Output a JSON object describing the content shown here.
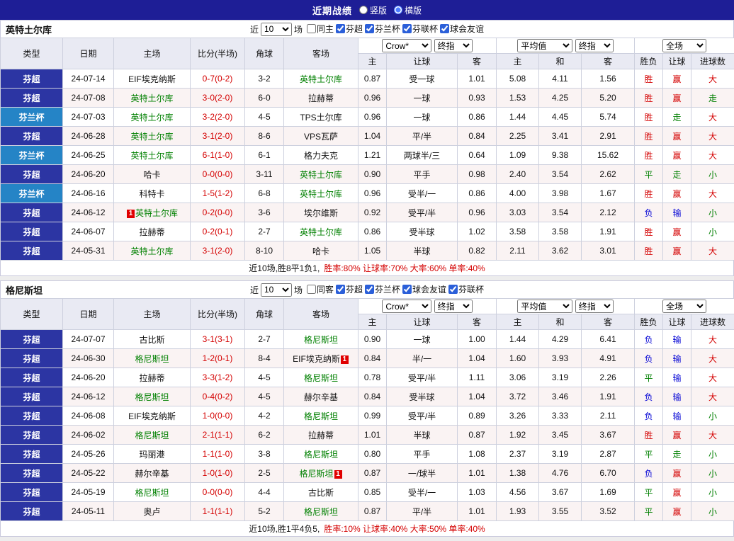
{
  "topbar": {
    "title": "近期战绩",
    "layout_options": [
      {
        "label": "竖版",
        "checked": false
      },
      {
        "label": "横版",
        "checked": true
      }
    ]
  },
  "table": {
    "columns": {
      "type": "类型",
      "date": "日期",
      "home": "主场",
      "score": "比分(半场)",
      "corner": "角球",
      "away": "客场",
      "odds_home": "主",
      "odds_handicap": "让球",
      "odds_away": "客",
      "avg_home": "主",
      "avg_draw": "和",
      "avg_away": "客",
      "res_wdl": "胜负",
      "res_handicap": "让球",
      "res_goals": "进球数"
    },
    "selects": {
      "odds_source": "Crow*",
      "odds_time": "终指",
      "avg_source": "平均值",
      "avg_time": "终指",
      "scope": "全场"
    }
  },
  "colors": {
    "topbar_bg": "#1e1e96",
    "league_super_bg": "#2c35a3",
    "league_cup_bg": "#2584c6",
    "win_red": "#d40000",
    "draw_green": "#008000",
    "loss_blue": "#0000d4"
  },
  "sections": [
    {
      "team": "英特土尔库",
      "filter": {
        "prefix": "近",
        "count": "10",
        "suffix": "场",
        "checkboxes": [
          {
            "label": "同主",
            "checked": false
          },
          {
            "label": "芬超",
            "checked": true
          },
          {
            "label": "芬兰杯",
            "checked": true
          },
          {
            "label": "芬联杯",
            "checked": true
          },
          {
            "label": "球会友谊",
            "checked": true
          }
        ]
      },
      "rows": [
        {
          "type": "芬超",
          "date": "24-07-14",
          "home": "EIF埃克纳斯",
          "score": "0-7(0-2)",
          "corner": "3-2",
          "away": "英特土尔库",
          "away_focus": true,
          "odds": [
            "0.87",
            "受一球",
            "1.01"
          ],
          "avg": [
            "5.08",
            "4.11",
            "1.56"
          ],
          "results": [
            "胜",
            "赢",
            "大"
          ]
        },
        {
          "type": "芬超",
          "date": "24-07-08",
          "home": "英特土尔库",
          "home_focus": true,
          "score": "3-0(2-0)",
          "corner": "6-0",
          "away": "拉赫蒂",
          "odds": [
            "0.96",
            "一球",
            "0.93"
          ],
          "avg": [
            "1.53",
            "4.25",
            "5.20"
          ],
          "results": [
            "胜",
            "赢",
            "走"
          ]
        },
        {
          "type": "芬兰杯",
          "date": "24-07-03",
          "home": "英特土尔库",
          "home_focus": true,
          "score": "3-2(2-0)",
          "corner": "4-5",
          "away": "TPS土尔库",
          "odds": [
            "0.96",
            "一球",
            "0.86"
          ],
          "avg": [
            "1.44",
            "4.45",
            "5.74"
          ],
          "results": [
            "胜",
            "走",
            "大"
          ]
        },
        {
          "type": "芬超",
          "date": "24-06-28",
          "home": "英特土尔库",
          "home_focus": true,
          "score": "3-1(2-0)",
          "corner": "8-6",
          "away": "VPS瓦萨",
          "odds": [
            "1.04",
            "平/半",
            "0.84"
          ],
          "avg": [
            "2.25",
            "3.41",
            "2.91"
          ],
          "results": [
            "胜",
            "赢",
            "大"
          ]
        },
        {
          "type": "芬兰杯",
          "date": "24-06-25",
          "home": "英特土尔库",
          "home_focus": true,
          "score": "6-1(1-0)",
          "corner": "6-1",
          "away": "格力夫克",
          "odds": [
            "1.21",
            "两球半/三",
            "0.64"
          ],
          "avg": [
            "1.09",
            "9.38",
            "15.62"
          ],
          "results": [
            "胜",
            "赢",
            "大"
          ]
        },
        {
          "type": "芬超",
          "date": "24-06-20",
          "home": "哈卡",
          "score": "0-0(0-0)",
          "corner": "3-11",
          "away": "英特土尔库",
          "away_focus": true,
          "odds": [
            "0.90",
            "平手",
            "0.98"
          ],
          "avg": [
            "2.40",
            "3.54",
            "2.62"
          ],
          "results": [
            "平",
            "走",
            "小"
          ]
        },
        {
          "type": "芬兰杯",
          "date": "24-06-16",
          "home": "科特卡",
          "score": "1-5(1-2)",
          "corner": "6-8",
          "away": "英特土尔库",
          "away_focus": true,
          "odds": [
            "0.96",
            "受半/一",
            "0.86"
          ],
          "avg": [
            "4.00",
            "3.98",
            "1.67"
          ],
          "results": [
            "胜",
            "赢",
            "大"
          ]
        },
        {
          "type": "芬超",
          "date": "24-06-12",
          "home": "英特土尔库",
          "home_focus": true,
          "home_badge": "1",
          "home_badge_pos": "before",
          "score": "0-2(0-0)",
          "corner": "3-6",
          "away": "埃尔维斯",
          "odds": [
            "0.92",
            "受平/半",
            "0.96"
          ],
          "avg": [
            "3.03",
            "3.54",
            "2.12"
          ],
          "results": [
            "负",
            "输",
            "小"
          ]
        },
        {
          "type": "芬超",
          "date": "24-06-07",
          "home": "拉赫蒂",
          "score": "0-2(0-1)",
          "corner": "2-7",
          "away": "英特土尔库",
          "away_focus": true,
          "odds": [
            "0.86",
            "受半球",
            "1.02"
          ],
          "avg": [
            "3.58",
            "3.58",
            "1.91"
          ],
          "results": [
            "胜",
            "赢",
            "小"
          ]
        },
        {
          "type": "芬超",
          "date": "24-05-31",
          "home": "英特土尔库",
          "home_focus": true,
          "score": "3-1(2-0)",
          "corner": "8-10",
          "away": "哈卡",
          "odds": [
            "1.05",
            "半球",
            "0.82"
          ],
          "avg": [
            "2.11",
            "3.62",
            "3.01"
          ],
          "results": [
            "胜",
            "赢",
            "大"
          ]
        }
      ],
      "summary_plain": "近10场,胜8平1负1,",
      "summary_stats": "胜率:80% 让球率:70% 大率:60% 单率:40%"
    },
    {
      "team": "格尼斯坦",
      "filter": {
        "prefix": "近",
        "count": "10",
        "suffix": "场",
        "checkboxes": [
          {
            "label": "同客",
            "checked": false
          },
          {
            "label": "芬超",
            "checked": true
          },
          {
            "label": "芬兰杯",
            "checked": true
          },
          {
            "label": "球会友谊",
            "checked": true
          },
          {
            "label": "芬联杯",
            "checked": true
          }
        ]
      },
      "rows": [
        {
          "type": "芬超",
          "date": "24-07-07",
          "home": "古比斯",
          "score": "3-1(3-1)",
          "corner": "2-7",
          "away": "格尼斯坦",
          "away_focus": true,
          "odds": [
            "0.90",
            "一球",
            "1.00"
          ],
          "avg": [
            "1.44",
            "4.29",
            "6.41"
          ],
          "results": [
            "负",
            "输",
            "大"
          ]
        },
        {
          "type": "芬超",
          "date": "24-06-30",
          "home": "格尼斯坦",
          "home_focus": true,
          "score": "1-2(0-1)",
          "corner": "8-4",
          "away": "EIF埃克纳斯",
          "away_badge": "1",
          "away_badge_pos": "after",
          "odds": [
            "0.84",
            "半/一",
            "1.04"
          ],
          "avg": [
            "1.60",
            "3.93",
            "4.91"
          ],
          "results": [
            "负",
            "输",
            "大"
          ]
        },
        {
          "type": "芬超",
          "date": "24-06-20",
          "home": "拉赫蒂",
          "score": "3-3(1-2)",
          "corner": "4-5",
          "away": "格尼斯坦",
          "away_focus": true,
          "odds": [
            "0.78",
            "受平/半",
            "1.11"
          ],
          "avg": [
            "3.06",
            "3.19",
            "2.26"
          ],
          "results": [
            "平",
            "输",
            "大"
          ]
        },
        {
          "type": "芬超",
          "date": "24-06-12",
          "home": "格尼斯坦",
          "home_focus": true,
          "score": "0-4(0-2)",
          "corner": "4-5",
          "away": "赫尔辛基",
          "odds": [
            "0.84",
            "受半球",
            "1.04"
          ],
          "avg": [
            "3.72",
            "3.46",
            "1.91"
          ],
          "results": [
            "负",
            "输",
            "大"
          ]
        },
        {
          "type": "芬超",
          "date": "24-06-08",
          "home": "EIF埃克纳斯",
          "score": "1-0(0-0)",
          "corner": "4-2",
          "away": "格尼斯坦",
          "away_focus": true,
          "odds": [
            "0.99",
            "受平/半",
            "0.89"
          ],
          "avg": [
            "3.26",
            "3.33",
            "2.11"
          ],
          "results": [
            "负",
            "输",
            "小"
          ]
        },
        {
          "type": "芬超",
          "date": "24-06-02",
          "home": "格尼斯坦",
          "home_focus": true,
          "score": "2-1(1-1)",
          "corner": "6-2",
          "away": "拉赫蒂",
          "odds": [
            "1.01",
            "半球",
            "0.87"
          ],
          "avg": [
            "1.92",
            "3.45",
            "3.67"
          ],
          "results": [
            "胜",
            "赢",
            "大"
          ]
        },
        {
          "type": "芬超",
          "date": "24-05-26",
          "home": "玛丽港",
          "score": "1-1(1-0)",
          "corner": "3-8",
          "away": "格尼斯坦",
          "away_focus": true,
          "odds": [
            "0.80",
            "平手",
            "1.08"
          ],
          "avg": [
            "2.37",
            "3.19",
            "2.87"
          ],
          "results": [
            "平",
            "走",
            "小"
          ]
        },
        {
          "type": "芬超",
          "date": "24-05-22",
          "home": "赫尔辛基",
          "score": "1-0(1-0)",
          "corner": "2-5",
          "away": "格尼斯坦",
          "away_focus": true,
          "away_badge": "1",
          "away_badge_pos": "after",
          "odds": [
            "0.87",
            "一/球半",
            "1.01"
          ],
          "avg": [
            "1.38",
            "4.76",
            "6.70"
          ],
          "results": [
            "负",
            "赢",
            "小"
          ]
        },
        {
          "type": "芬超",
          "date": "24-05-19",
          "home": "格尼斯坦",
          "home_focus": true,
          "score": "0-0(0-0)",
          "corner": "4-4",
          "away": "古比斯",
          "odds": [
            "0.85",
            "受半/一",
            "1.03"
          ],
          "avg": [
            "4.56",
            "3.67",
            "1.69"
          ],
          "results": [
            "平",
            "赢",
            "小"
          ]
        },
        {
          "type": "芬超",
          "date": "24-05-11",
          "home": "奥卢",
          "score": "1-1(1-1)",
          "corner": "5-2",
          "away": "格尼斯坦",
          "away_focus": true,
          "odds": [
            "0.87",
            "平/半",
            "1.01"
          ],
          "avg": [
            "1.93",
            "3.55",
            "3.52"
          ],
          "results": [
            "平",
            "赢",
            "小"
          ]
        }
      ],
      "summary_plain": "近10场,胜1平4负5,",
      "summary_stats": "胜率:10% 让球率:40% 大率:50% 单率:40%"
    }
  ]
}
